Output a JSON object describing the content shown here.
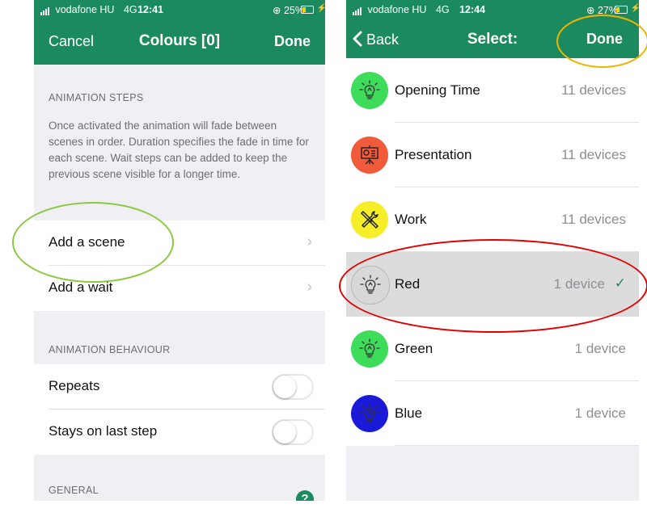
{
  "left": {
    "status": {
      "carrier": "vodafone HU",
      "network": "4G",
      "time": "12:41",
      "battery": "25%",
      "battery_level": 0.25
    },
    "nav": {
      "cancel": "Cancel",
      "title": "Colours [0]",
      "done": "Done"
    },
    "animation_steps": {
      "header": "ANIMATION STEPS",
      "description": "Once activated the animation will fade between scenes in order. Duration specifies the fade in time for each scene. Wait steps can be added to keep the previous scene visible for a longer time.",
      "items": [
        {
          "label": "Add a scene"
        },
        {
          "label": "Add a wait"
        }
      ]
    },
    "animation_behaviour": {
      "header": "ANIMATION BEHAVIOUR",
      "items": [
        {
          "label": "Repeats",
          "on": false
        },
        {
          "label": "Stays on last step",
          "on": false
        }
      ]
    },
    "general": {
      "header": "GENERAL",
      "help": "?"
    }
  },
  "right": {
    "status": {
      "carrier": "vodafone HU",
      "network": "4G",
      "time": "12:44",
      "battery": "27%",
      "battery_level": 0.27
    },
    "nav": {
      "back": "Back",
      "title": "Select:",
      "done": "Done"
    },
    "scenes": [
      {
        "name": "Opening Time",
        "count": "11 devices",
        "color": "#3ddc5a",
        "icon": "lightbulb-icon"
      },
      {
        "name": "Presentation",
        "count": "11 devices",
        "color": "#f25a3c",
        "icon": "presentation-icon"
      },
      {
        "name": "Work",
        "count": "11 devices",
        "color": "#f7ee2a",
        "icon": "tools-icon"
      },
      {
        "name": "Red",
        "count": "1 device",
        "color": "#d8d8d8",
        "icon": "lightbulb-icon",
        "selected": true
      },
      {
        "name": "Green",
        "count": "1 device",
        "color": "#3ddc5a",
        "icon": "lightbulb-icon"
      },
      {
        "name": "Blue",
        "count": "1 device",
        "color": "#1a1ad8",
        "icon": "lightbulb-icon"
      }
    ],
    "checkmark": "✓"
  },
  "colors": {
    "accent": "#1b8a5e",
    "annotation_green": "#8dc63f",
    "annotation_yellow": "#f0b400",
    "annotation_red": "#e00000"
  }
}
